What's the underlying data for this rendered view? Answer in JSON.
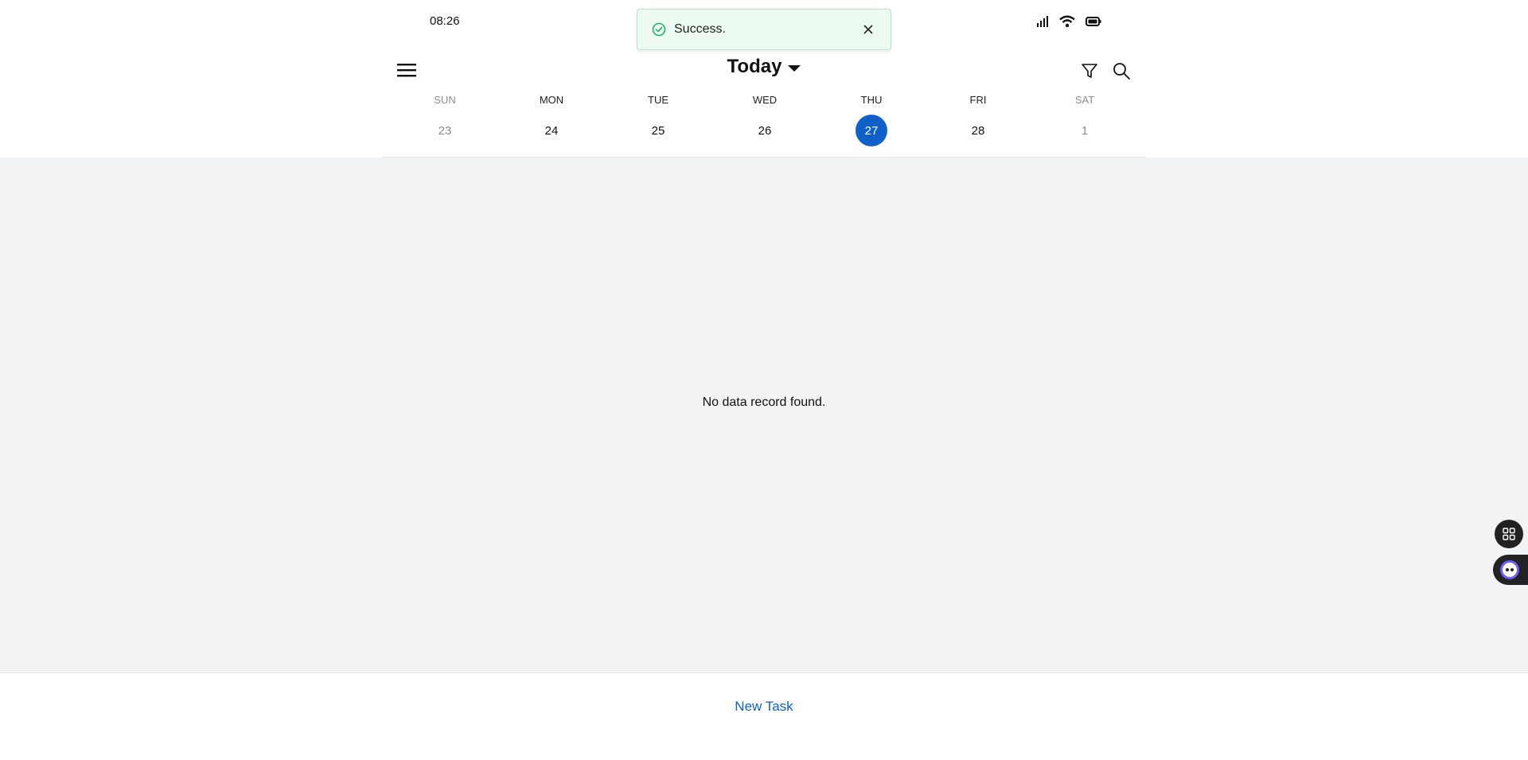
{
  "status_bar": {
    "time": "08:26",
    "icons": [
      "signal-icon",
      "wifi-icon",
      "battery-icon"
    ]
  },
  "toast": {
    "message": "Success.",
    "icon": "check-circle-icon",
    "close_icon": "close-icon",
    "colors": {
      "background": "#ecfaf1",
      "icon": "#22b35e"
    }
  },
  "header": {
    "title": "Today",
    "menu_icon": "hamburger-menu-icon",
    "tools": [
      "filter-icon",
      "search-icon"
    ]
  },
  "week": {
    "days": [
      {
        "dow": "SUN",
        "date": "23",
        "muted": true,
        "selected": false
      },
      {
        "dow": "MON",
        "date": "24",
        "muted": false,
        "selected": false
      },
      {
        "dow": "TUE",
        "date": "25",
        "muted": false,
        "selected": false
      },
      {
        "dow": "WED",
        "date": "26",
        "muted": false,
        "selected": false
      },
      {
        "dow": "THU",
        "date": "27",
        "muted": false,
        "selected": true
      },
      {
        "dow": "FRI",
        "date": "28",
        "muted": false,
        "selected": false
      },
      {
        "dow": "SAT",
        "date": "1",
        "muted": true,
        "selected": false
      }
    ],
    "accent": "#1060c9"
  },
  "content": {
    "empty_message": "No data record found."
  },
  "floating": {
    "apps_icon": "apps-grid-icon",
    "assistant_icon": "assistant-bot-icon"
  },
  "footer": {
    "new_task_label": "New Task"
  }
}
